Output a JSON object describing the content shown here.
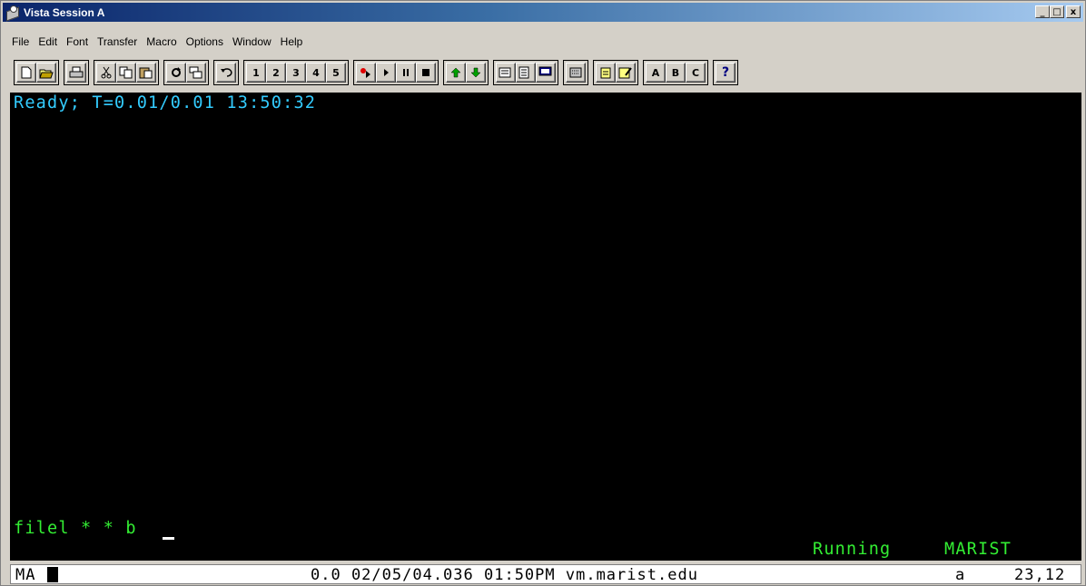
{
  "window": {
    "title": "Vista Session A",
    "controls": [
      "_",
      "□",
      "x"
    ]
  },
  "menubar": {
    "items": [
      "File",
      "Edit",
      "Font",
      "Transfer",
      "Macro",
      "Options",
      "Window",
      "Help"
    ]
  },
  "toolbar": {
    "groups": [
      [
        "new-icon",
        "open-icon"
      ],
      [
        "print-icon"
      ],
      [
        "cut-icon",
        "copy-icon",
        "paste-icon"
      ],
      [
        "refresh-icon",
        "paste-special-icon"
      ],
      [
        "undo-icon"
      ],
      [
        "1",
        "2",
        "3",
        "4",
        "5"
      ],
      [
        "record-icon",
        "play-icon",
        "pause-icon",
        "stop-icon"
      ],
      [
        "up-arrow-icon",
        "down-arrow-icon"
      ],
      [
        "properties-icon",
        "notes-icon",
        "screen-icon"
      ],
      [
        "keyboard-icon"
      ],
      [
        "clipboard-icon",
        "notepad-icon"
      ],
      [
        "A",
        "B",
        "C"
      ],
      [
        "?"
      ]
    ]
  },
  "terminal": {
    "line1": "Ready; T=0.01/0.01 13:50:32",
    "command": "filel * * b",
    "status_running": "Running",
    "status_host": "MARIST",
    "colors": {
      "output": "#33ccff",
      "input": "#33ee33",
      "background": "#000000"
    }
  },
  "statusbar": {
    "indicator": "MA",
    "lock_symbol": "A",
    "info": "0.0 02/05/04.036 01:50PM vm.marist.edu",
    "mode": "a",
    "cursor_position": "23,12"
  }
}
